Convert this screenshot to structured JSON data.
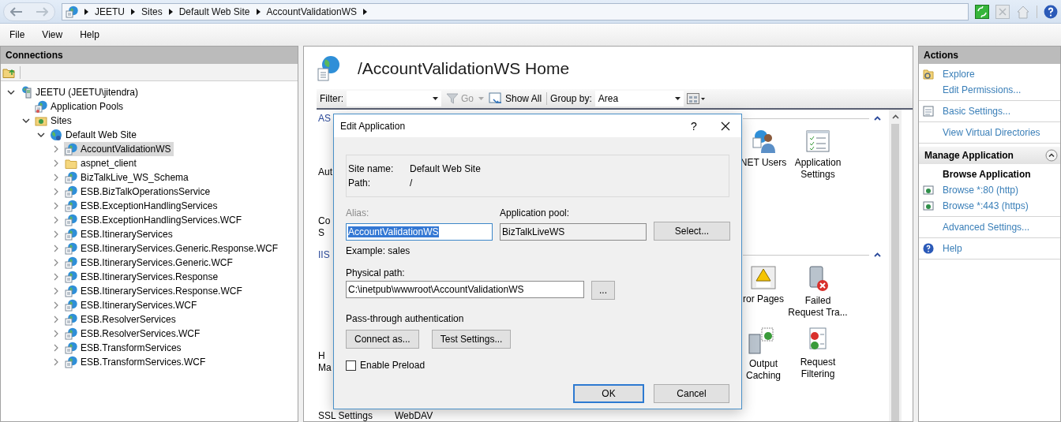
{
  "address_bar": {
    "breadcrumbs": [
      "JEETU",
      "Sites",
      "Default Web Site",
      "AccountValidationWS"
    ]
  },
  "menu": [
    "File",
    "View",
    "Help"
  ],
  "connections": {
    "title": "Connections",
    "tree": [
      {
        "label": "JEETU (JEETU\\jitendra)",
        "kind": "server",
        "expanded": true,
        "selected": false,
        "children": [
          {
            "label": "Application Pools",
            "kind": "pools",
            "selected": false
          },
          {
            "label": "Sites",
            "kind": "sites",
            "expanded": true,
            "selected": false,
            "children": [
              {
                "label": "Default Web Site",
                "kind": "site",
                "expanded": true,
                "selected": false,
                "children": [
                  {
                    "label": "AccountValidationWS",
                    "kind": "app",
                    "expanded": false,
                    "selected": true
                  },
                  {
                    "label": "aspnet_client",
                    "kind": "folder",
                    "expanded": false,
                    "selected": false
                  },
                  {
                    "label": "BizTalkLive_WS_Schema",
                    "kind": "app",
                    "expanded": false,
                    "selected": false
                  },
                  {
                    "label": "ESB.BizTalkOperationsService",
                    "kind": "app",
                    "expanded": false,
                    "selected": false
                  },
                  {
                    "label": "ESB.ExceptionHandlingServices",
                    "kind": "app",
                    "expanded": false,
                    "selected": false
                  },
                  {
                    "label": "ESB.ExceptionHandlingServices.WCF",
                    "kind": "app",
                    "expanded": false,
                    "selected": false
                  },
                  {
                    "label": "ESB.ItineraryServices",
                    "kind": "app",
                    "expanded": false,
                    "selected": false
                  },
                  {
                    "label": "ESB.ItineraryServices.Generic.Response.WCF",
                    "kind": "app",
                    "expanded": false,
                    "selected": false
                  },
                  {
                    "label": "ESB.ItineraryServices.Generic.WCF",
                    "kind": "app",
                    "expanded": false,
                    "selected": false
                  },
                  {
                    "label": "ESB.ItineraryServices.Response",
                    "kind": "app",
                    "expanded": false,
                    "selected": false
                  },
                  {
                    "label": "ESB.ItineraryServices.Response.WCF",
                    "kind": "app",
                    "expanded": false,
                    "selected": false
                  },
                  {
                    "label": "ESB.ItineraryServices.WCF",
                    "kind": "app",
                    "expanded": false,
                    "selected": false
                  },
                  {
                    "label": "ESB.ResolverServices",
                    "kind": "app",
                    "expanded": false,
                    "selected": false
                  },
                  {
                    "label": "ESB.ResolverServices.WCF",
                    "kind": "app",
                    "expanded": false,
                    "selected": false
                  },
                  {
                    "label": "ESB.TransformServices",
                    "kind": "app",
                    "expanded": false,
                    "selected": false
                  },
                  {
                    "label": "ESB.TransformServices.WCF",
                    "kind": "app",
                    "expanded": false,
                    "selected": false
                  }
                ]
              }
            ]
          }
        ]
      }
    ]
  },
  "content": {
    "title": "/AccountValidationWS Home",
    "toolbar": {
      "filter_label": "Filter:",
      "go": "Go",
      "show_all": "Show All",
      "group_by_label": "Group by:",
      "group_by_value": "Area"
    },
    "groups": [
      {
        "header": "AS",
        "strip": [
          {
            "lines": [
              "Aut"
            ]
          },
          {
            "lines": [
              "Co",
              "S"
            ]
          }
        ],
        "items": [
          {
            "kind": "users",
            "lines": [
              "NET Users"
            ]
          },
          {
            "kind": "settings",
            "lines": [
              "Application",
              "Settings"
            ]
          }
        ]
      },
      {
        "header": "IIS",
        "strip": [
          {
            "lines": [
              "H",
              "Ma"
            ]
          }
        ],
        "items": [
          {
            "kind": "error",
            "lines": [
              "ror Pages"
            ]
          },
          {
            "kind": "failed",
            "lines": [
              "Failed",
              "Request Tra..."
            ]
          },
          {
            "kind": "cache",
            "lines": [
              "Output",
              "Caching"
            ]
          },
          {
            "kind": "filter",
            "lines": [
              "Request",
              "Filtering"
            ]
          }
        ]
      }
    ],
    "bottom_row": [
      "SSL Settings",
      "WebDAV"
    ]
  },
  "dialog": {
    "title": "Edit Application",
    "help": "?",
    "info": [
      {
        "label": "Site name:",
        "value": "Default Web Site"
      },
      {
        "label": "Path:",
        "value": "/"
      }
    ],
    "alias": {
      "label": "Alias:",
      "label_disabled": true,
      "value": "AccountValidationWS",
      "selected": true
    },
    "app_pool": {
      "label": "Application pool:",
      "value": "BizTalkLiveWS",
      "button": "Select..."
    },
    "example": "Example: sales",
    "physical_path": {
      "label": "Physical path:",
      "value": "C:\\inetpub\\wwwroot\\AccountValidationWS",
      "button": "..."
    },
    "pass_through": {
      "label": "Pass-through authentication",
      "buttons": [
        "Connect as...",
        "Test Settings..."
      ]
    },
    "preload": {
      "label": "Enable Preload",
      "checked": false
    },
    "buttons": [
      {
        "label": "OK",
        "default": true
      },
      {
        "label": "Cancel",
        "default": false
      }
    ]
  },
  "actions": {
    "title": "Actions",
    "blocks": [
      [
        {
          "label": "Explore",
          "kind": "explore"
        },
        {
          "label": "Edit Permissions...",
          "kind": "link"
        }
      ],
      [
        {
          "label": "Basic Settings...",
          "kind": "settings"
        }
      ],
      [
        {
          "label": "View Virtual Directories",
          "kind": "link"
        }
      ]
    ],
    "sections": [
      {
        "title": "Manage Application",
        "expanded": true,
        "blocks": [
          [
            {
              "label": "Browse Application",
              "kind": "heading"
            },
            {
              "label": "Browse *:80 (http)",
              "kind": "browse"
            },
            {
              "label": "Browse *:443 (https)",
              "kind": "browse"
            }
          ],
          [
            {
              "label": "Advanced Settings...",
              "kind": "link"
            }
          ],
          [
            {
              "label": "Help",
              "kind": "help"
            }
          ]
        ]
      }
    ]
  }
}
